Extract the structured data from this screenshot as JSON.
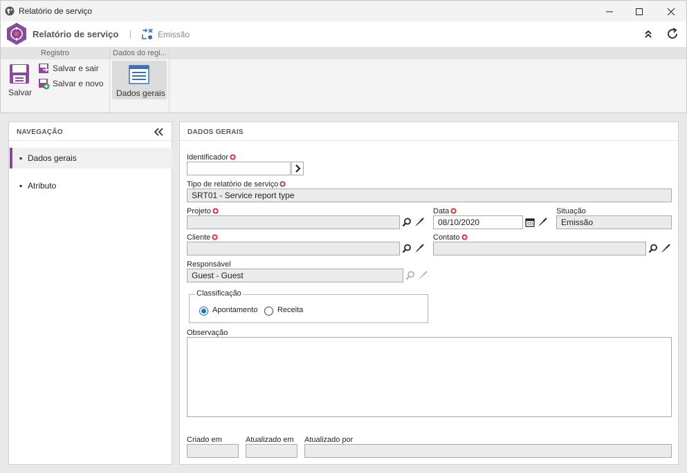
{
  "window": {
    "title": "Relatório de serviço"
  },
  "header": {
    "app_title": "Relatório de serviço",
    "separator": "|",
    "status": "Emissão"
  },
  "ribbon": {
    "groups": [
      "Registro",
      "Dados do regi..."
    ],
    "save": "Salvar",
    "save_exit": "Salvar e sair",
    "save_new": "Salvar e novo",
    "general_data": "Dados gerais"
  },
  "nav": {
    "title": "NAVEGAÇÃO",
    "items": [
      {
        "bullet": "▪",
        "label": "Dados gerais"
      },
      {
        "bullet": "▪",
        "label": "Atributo"
      }
    ]
  },
  "form": {
    "title": "DADOS GERAIS",
    "identifier": {
      "label": "Identificador",
      "value": ""
    },
    "type": {
      "label": "Tipo de relatório de serviço",
      "value": "SRT01 - Service report type"
    },
    "project": {
      "label": "Projeto",
      "value": ""
    },
    "date": {
      "label": "Data",
      "value": "08/10/2020"
    },
    "situation": {
      "label": "Situação",
      "value": "Emissão"
    },
    "client": {
      "label": "Cliente",
      "value": ""
    },
    "contact": {
      "label": "Contato",
      "value": ""
    },
    "responsible": {
      "label": "Responsável",
      "value": "Guest - Guest"
    },
    "classification": {
      "label": "Classificação",
      "options": [
        "Apontamento",
        "Receita"
      ],
      "selected": "Apontamento"
    },
    "observation": {
      "label": "Observação",
      "value": ""
    },
    "created_at": {
      "label": "Criado em",
      "value": ""
    },
    "updated_at": {
      "label": "Atualizado em",
      "value": ""
    },
    "updated_by": {
      "label": "Atualizado por",
      "value": ""
    }
  },
  "colors": {
    "accent": "#8a4a9b",
    "required": "#d9232e",
    "radio": "#1e73be"
  }
}
